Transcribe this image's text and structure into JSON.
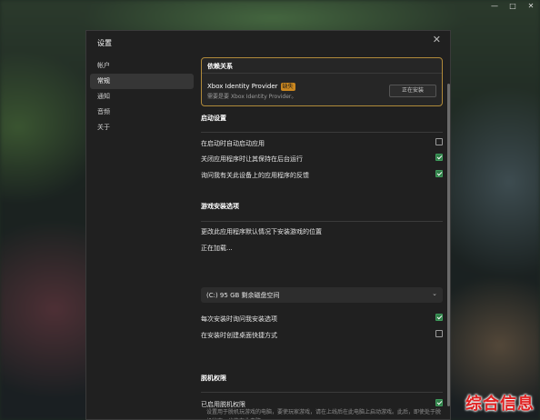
{
  "window_controls": {
    "minimize": "—",
    "maximize": "□",
    "close": "✕"
  },
  "dialog": {
    "title": "设置",
    "close": "✕",
    "nav": [
      {
        "label": "帐户",
        "active": false
      },
      {
        "label": "常规",
        "active": true
      },
      {
        "label": "通知",
        "active": false
      },
      {
        "label": "音频",
        "active": false
      },
      {
        "label": "关于",
        "active": false
      }
    ]
  },
  "dependency": {
    "title": "依赖关系",
    "name": "Xbox Identity Provider",
    "badge": "缺失",
    "subtitle": "需要是要 Xbox Identity Provider。",
    "button": "正在安装"
  },
  "startup": {
    "heading": "启动设置",
    "items": [
      {
        "label": "在启动时自动启动应用",
        "checked": false
      },
      {
        "label": "关闭应用程序时让其保持在后台运行",
        "checked": true
      },
      {
        "label": "询问我有关此设备上的应用程序的反馈",
        "checked": true
      }
    ]
  },
  "game_install": {
    "heading": "游戏安装选项",
    "location_label": "更改此应用程序默认情况下安装游戏的位置",
    "loading": "正在加载...",
    "drive_select": "(C:) 95 GB 剩余磁盘空间",
    "items": [
      {
        "label": "每次安装时询问我安装选项",
        "checked": true
      },
      {
        "label": "在安装时创建桌面快捷方式",
        "checked": false
      }
    ]
  },
  "offline": {
    "heading": "脱机权限",
    "enabled_label": "已启用脱机权限",
    "enabled_checked": true,
    "description": "设置用于脱机玩游戏的电脑，要使玩家游戏，请在上线后在此电脑上启动游戏。此后，即使处于脱机状态，也能在此电脑..."
  },
  "watermark": "综合信息"
}
